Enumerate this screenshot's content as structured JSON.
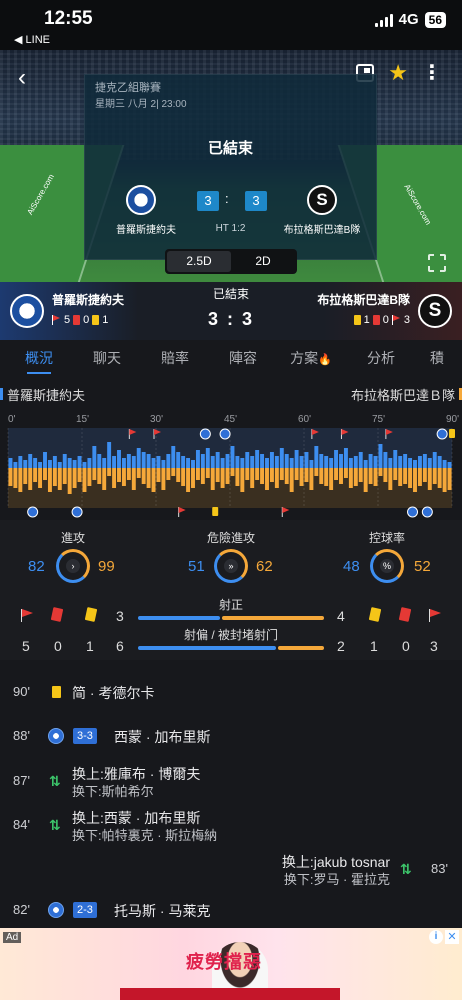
{
  "status_bar": {
    "time": "12:55",
    "back_app": "LINE",
    "network": "4G",
    "battery": "56"
  },
  "header": {
    "league": "捷克乙組聯賽",
    "datetime": "星期三 八月 2| 23:00",
    "status": "已結束",
    "home_team": "普羅斯捷約夫",
    "away_team": "布拉格斯巴達B隊",
    "home_score": "3",
    "away_score": "3",
    "separator": ":",
    "halftime": "HT 1:2",
    "view_options": [
      "2.5D",
      "2D"
    ],
    "watermark": "AiScore.com"
  },
  "team_bar": {
    "status": "已結束",
    "home_name": "普羅斯捷約夫",
    "away_name": "布拉格斯巴達B隊",
    "score": "3 : 3",
    "home_corners": "5",
    "home_red": "0",
    "home_yellow": "1",
    "away_yellow": "1",
    "away_red": "0",
    "away_corners": "3"
  },
  "tabs": [
    "概況",
    "聊天",
    "賠率",
    "陣容",
    "方案",
    "分析",
    "積"
  ],
  "team_row": {
    "home": "普羅斯捷約夫",
    "away": "布拉格斯巴達Ｂ隊"
  },
  "momentum": {
    "time_labels": [
      "0'",
      "15'",
      "30'",
      "45'",
      "60'",
      "75'",
      "90'"
    ],
    "home_values": [
      0.25,
      0.15,
      0.3,
      0.2,
      0.35,
      0.25,
      0.15,
      0.4,
      0.2,
      0.3,
      0.15,
      0.35,
      0.25,
      0.2,
      0.3,
      0.15,
      0.25,
      0.55,
      0.35,
      0.25,
      0.65,
      0.3,
      0.45,
      0.25,
      0.35,
      0.3,
      0.5,
      0.4,
      0.35,
      0.25,
      0.3,
      0.2,
      0.35,
      0.55,
      0.4,
      0.3,
      0.25,
      0.2,
      0.45,
      0.35,
      0.5,
      0.3,
      0.4,
      0.25,
      0.35,
      0.55,
      0.3,
      0.25,
      0.4,
      0.3,
      0.45,
      0.35,
      0.25,
      0.4,
      0.3,
      0.5,
      0.35,
      0.25,
      0.45,
      0.3,
      0.4,
      0.2,
      0.55,
      0.35,
      0.3,
      0.25,
      0.45,
      0.35,
      0.5,
      0.25,
      0.3,
      0.4,
      0.2,
      0.35,
      0.3,
      0.6,
      0.4,
      0.25,
      0.45,
      0.3,
      0.35,
      0.25,
      0.2,
      0.3,
      0.35,
      0.25,
      0.4,
      0.3,
      0.2,
      0.15
    ],
    "away_values": [
      0.45,
      0.5,
      0.6,
      0.4,
      0.55,
      0.35,
      0.5,
      0.3,
      0.6,
      0.45,
      0.55,
      0.4,
      0.65,
      0.5,
      0.35,
      0.6,
      0.45,
      0.3,
      0.4,
      0.55,
      0.2,
      0.5,
      0.35,
      0.45,
      0.3,
      0.55,
      0.25,
      0.4,
      0.5,
      0.6,
      0.35,
      0.55,
      0.3,
      0.2,
      0.35,
      0.45,
      0.6,
      0.5,
      0.3,
      0.4,
      0.25,
      0.55,
      0.35,
      0.5,
      0.4,
      0.2,
      0.45,
      0.6,
      0.3,
      0.5,
      0.3,
      0.4,
      0.55,
      0.35,
      0.5,
      0.3,
      0.4,
      0.6,
      0.3,
      0.45,
      0.35,
      0.55,
      0.2,
      0.4,
      0.45,
      0.55,
      0.3,
      0.4,
      0.25,
      0.5,
      0.45,
      0.35,
      0.6,
      0.4,
      0.45,
      0.2,
      0.35,
      0.55,
      0.3,
      0.45,
      0.4,
      0.5,
      0.6,
      0.45,
      0.35,
      0.55,
      0.4,
      0.5,
      0.6,
      0.55
    ],
    "home_events": [
      {
        "minute": 40,
        "type": "goal"
      },
      {
        "minute": 44,
        "type": "goal"
      },
      {
        "minute": 88,
        "type": "goal"
      },
      {
        "minute": 90,
        "type": "yellow"
      },
      {
        "minute": 25,
        "type": "corner"
      },
      {
        "minute": 30,
        "type": "corner"
      },
      {
        "minute": 62,
        "type": "corner"
      },
      {
        "minute": 68,
        "type": "corner"
      },
      {
        "minute": 77,
        "type": "corner"
      }
    ],
    "away_events": [
      {
        "minute": 5,
        "type": "goal"
      },
      {
        "minute": 14,
        "type": "goal"
      },
      {
        "minute": 82,
        "type": "goal"
      },
      {
        "minute": 85,
        "type": "goal"
      },
      {
        "minute": 42,
        "type": "yellow"
      },
      {
        "minute": 35,
        "type": "corner"
      },
      {
        "minute": 56,
        "type": "corner"
      }
    ]
  },
  "stats": {
    "attack": {
      "label": "進攻",
      "home": "82",
      "away": "99",
      "icon": "›"
    },
    "dangerous": {
      "label": "危險進攻",
      "home": "51",
      "away": "62",
      "icon": "»"
    },
    "possession": {
      "label": "控球率",
      "home": "48",
      "away": "52",
      "icon": "%"
    },
    "shots_on_target": {
      "label": "射正",
      "home": "3",
      "away": "4"
    },
    "shots_off": {
      "label": "射偏 / 被封堵射门",
      "home": "6",
      "away": "2"
    },
    "home_corners": "5",
    "home_red": "0",
    "home_yellow": "1",
    "away_yellow": "1",
    "away_red": "0",
    "away_corners": "3"
  },
  "events": [
    {
      "minute": "90'",
      "side": "home",
      "type": "yellow",
      "text": "简 · 考德尔卡"
    },
    {
      "minute": "88'",
      "side": "home",
      "type": "goal",
      "score": "3-3",
      "text": "西蒙 · 加布里斯"
    },
    {
      "minute": "87'",
      "side": "home",
      "type": "sub",
      "in": "换上:雅庫布 · 博爾夫",
      "out": "换下:斯帕希尔"
    },
    {
      "minute": "84'",
      "side": "home",
      "type": "sub",
      "in": "换上:西蒙 · 加布里斯",
      "out": "换下:帕特裏克 · 斯拉梅納"
    },
    {
      "minute": "83'",
      "side": "away",
      "type": "sub",
      "in": "换上:jakub tosnar",
      "out": "换下:罗马 · 霍拉克"
    },
    {
      "minute": "82'",
      "side": "home",
      "type": "goal",
      "score": "2-3",
      "text": "托马斯 · 马莱克"
    }
  ],
  "ad": {
    "tag": "Ad",
    "headline": "疲勞擋惡",
    "info": "i",
    "close": "✕"
  },
  "colors": {
    "home": "#3d8ef0",
    "away": "#f5a83a",
    "accent": "#3d8ef0"
  }
}
